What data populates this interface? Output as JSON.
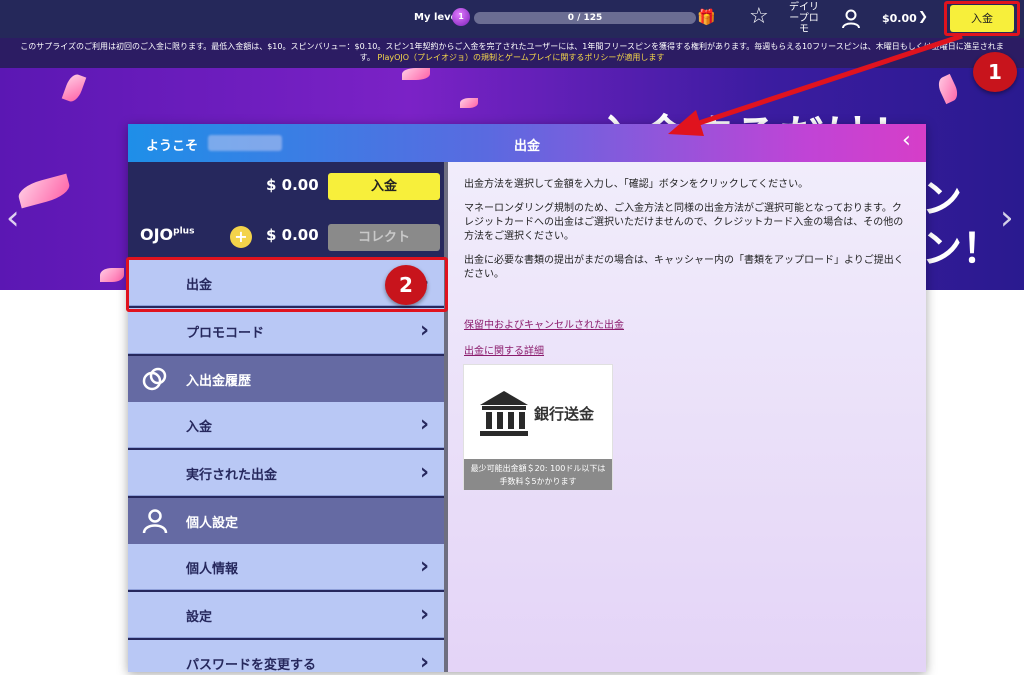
{
  "topbar": {
    "level_label": "My level",
    "level_badge": "1",
    "progress_text": "0 / 125",
    "progress_fraction": 0.0,
    "daily_promo": "デイリープロモ",
    "balance": "$0.00",
    "deposit_button": "入金",
    "annotation_1": "1"
  },
  "disclaimer": {
    "text": "このサプライズのご利用は初回のご入金に限ります。最低入金額は、$10。スピンバリュー：$0.10。スピン1年契約からご入金を完了されたユーザーには、1年間フリースピンを獲得する権利があります。毎週もらえる10フリースピンは、木曜日もしくは金曜日に進呈されます。",
    "policy_link": "PlayOJO（プレイオジョ）の規制とゲームプレイに関するポリシーが適用します"
  },
  "hero": {
    "title": "入金するだけ！",
    "side_line1": "ン",
    "side_line2": "ン！"
  },
  "panel": {
    "welcome": "ようこそ",
    "title": "出金",
    "balance_amount": "$ 0.00",
    "deposit_button": "入金",
    "ojo_logo": "OJO",
    "ojo_logo_sup": "plus",
    "ojoplus_amount": "$ 0.00",
    "collect_button": "コレクト",
    "menu": [
      {
        "label": "出金",
        "type": "item"
      },
      {
        "label": "プロモコード",
        "type": "item"
      },
      {
        "label": "入出金履歴",
        "type": "section"
      },
      {
        "label": "入金",
        "type": "item"
      },
      {
        "label": "実行された出金",
        "type": "item"
      },
      {
        "label": "個人設定",
        "type": "section"
      },
      {
        "label": "個人情報",
        "type": "item"
      },
      {
        "label": "設定",
        "type": "item"
      },
      {
        "label": "パスワードを変更する",
        "type": "item"
      }
    ],
    "annotation_2": "2"
  },
  "content": {
    "para1": "出金方法を選択して金額を入力し、「確認」ボタンをクリックしてください。",
    "para2": "マネーロンダリング規制のため、ご入金方法と同様の出金方法がご選択可能となっております。クレジットカードへの出金はご選択いただけませんので、クレジットカード入金の場合は、その他の方法をご選択ください。",
    "para3": "出金に必要な書類の提出がまだの場合は、キャッシャー内の「書類をアップロード」よりご提出ください。",
    "link1": "保留中およびキャンセルされた出金",
    "link2": "出金に関する詳細",
    "bank_label": "銀行送金",
    "bank_note_line1": "最少可能出金額＄20: 100ドル以下は",
    "bank_note_line2": "手数料＄5かかります"
  },
  "colors": {
    "topbar_bg": "#25285a",
    "accent_yellow": "#f7ef3b",
    "annotation_red": "#e0131e",
    "menu_item_bg": "#b9c8f5",
    "menu_section_bg": "#656aa3",
    "link_color": "#8b1c6d"
  }
}
